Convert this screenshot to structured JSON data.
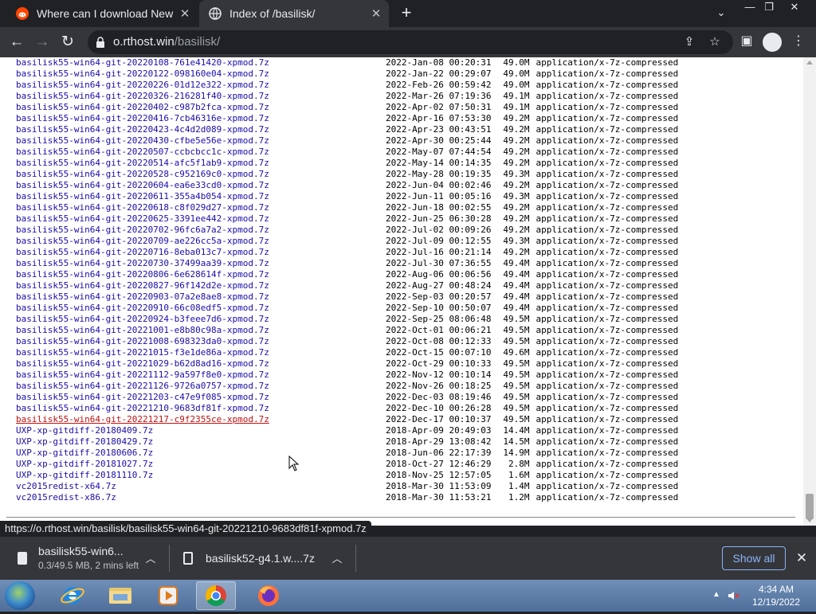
{
  "browser": {
    "tabs": [
      {
        "title": "Where can I download New M",
        "favicon": "reddit-icon",
        "active": false
      },
      {
        "title": "Index of /basilisk/",
        "favicon": "globe-icon",
        "active": true
      }
    ],
    "address": {
      "host": "o.rthost.win",
      "path": "/basilisk/"
    }
  },
  "listing": [
    {
      "name": "basilisk55-win64-git-20220108-761e41420-xpmod.7z",
      "date": "2022-Jan-08 00:20:31",
      "size": "49.0M",
      "type": "application/x-7z-compressed"
    },
    {
      "name": "basilisk55-win64-git-20220122-098160e04-xpmod.7z",
      "date": "2022-Jan-22 00:29:07",
      "size": "49.0M",
      "type": "application/x-7z-compressed"
    },
    {
      "name": "basilisk55-win64-git-20220226-01d12e322-xpmod.7z",
      "date": "2022-Feb-26 00:59:42",
      "size": "49.0M",
      "type": "application/x-7z-compressed"
    },
    {
      "name": "basilisk55-win64-git-20220326-216281f40-xpmod.7z",
      "date": "2022-Mar-26 07:19:36",
      "size": "49.1M",
      "type": "application/x-7z-compressed"
    },
    {
      "name": "basilisk55-win64-git-20220402-c987b2fca-xpmod.7z",
      "date": "2022-Apr-02 07:50:31",
      "size": "49.1M",
      "type": "application/x-7z-compressed"
    },
    {
      "name": "basilisk55-win64-git-20220416-7cb46316e-xpmod.7z",
      "date": "2022-Apr-16 07:53:30",
      "size": "49.2M",
      "type": "application/x-7z-compressed"
    },
    {
      "name": "basilisk55-win64-git-20220423-4c4d2d089-xpmod.7z",
      "date": "2022-Apr-23 00:43:51",
      "size": "49.2M",
      "type": "application/x-7z-compressed"
    },
    {
      "name": "basilisk55-win64-git-20220430-cfbe5e56e-xpmod.7z",
      "date": "2022-Apr-30 00:25:44",
      "size": "49.2M",
      "type": "application/x-7z-compressed"
    },
    {
      "name": "basilisk55-win64-git-20220507-ccbcbcc1c-xpmod.7z",
      "date": "2022-May-07 07:44:54",
      "size": "49.2M",
      "type": "application/x-7z-compressed"
    },
    {
      "name": "basilisk55-win64-git-20220514-afc5f1ab9-xpmod.7z",
      "date": "2022-May-14 00:14:35",
      "size": "49.2M",
      "type": "application/x-7z-compressed"
    },
    {
      "name": "basilisk55-win64-git-20220528-c952169c0-xpmod.7z",
      "date": "2022-May-28 00:19:35",
      "size": "49.3M",
      "type": "application/x-7z-compressed"
    },
    {
      "name": "basilisk55-win64-git-20220604-ea6e33cd0-xpmod.7z",
      "date": "2022-Jun-04 00:02:46",
      "size": "49.2M",
      "type": "application/x-7z-compressed"
    },
    {
      "name": "basilisk55-win64-git-20220611-355a4b054-xpmod.7z",
      "date": "2022-Jun-11 00:05:16",
      "size": "49.3M",
      "type": "application/x-7z-compressed"
    },
    {
      "name": "basilisk55-win64-git-20220618-c8f029d27-xpmod.7z",
      "date": "2022-Jun-18 00:02:55",
      "size": "49.2M",
      "type": "application/x-7z-compressed"
    },
    {
      "name": "basilisk55-win64-git-20220625-3391ee442-xpmod.7z",
      "date": "2022-Jun-25 06:30:28",
      "size": "49.2M",
      "type": "application/x-7z-compressed"
    },
    {
      "name": "basilisk55-win64-git-20220702-96fc6a7a2-xpmod.7z",
      "date": "2022-Jul-02 00:09:26",
      "size": "49.2M",
      "type": "application/x-7z-compressed"
    },
    {
      "name": "basilisk55-win64-git-20220709-ae226cc5a-xpmod.7z",
      "date": "2022-Jul-09 00:12:55",
      "size": "49.3M",
      "type": "application/x-7z-compressed"
    },
    {
      "name": "basilisk55-win64-git-20220716-8eba013c7-xpmod.7z",
      "date": "2022-Jul-16 00:21:14",
      "size": "49.2M",
      "type": "application/x-7z-compressed"
    },
    {
      "name": "basilisk55-win64-git-20220730-37499aa39-xpmod.7z",
      "date": "2022-Jul-30 07:36:55",
      "size": "49.4M",
      "type": "application/x-7z-compressed"
    },
    {
      "name": "basilisk55-win64-git-20220806-6e628614f-xpmod.7z",
      "date": "2022-Aug-06 00:06:56",
      "size": "49.4M",
      "type": "application/x-7z-compressed"
    },
    {
      "name": "basilisk55-win64-git-20220827-96f142d2e-xpmod.7z",
      "date": "2022-Aug-27 00:48:24",
      "size": "49.4M",
      "type": "application/x-7z-compressed"
    },
    {
      "name": "basilisk55-win64-git-20220903-07a2e8ae8-xpmod.7z",
      "date": "2022-Sep-03 00:20:57",
      "size": "49.4M",
      "type": "application/x-7z-compressed"
    },
    {
      "name": "basilisk55-win64-git-20220910-66c08edf5-xpmod.7z",
      "date": "2022-Sep-10 00:50:07",
      "size": "49.4M",
      "type": "application/x-7z-compressed"
    },
    {
      "name": "basilisk55-win64-git-20220924-b3feee7d6-xpmod.7z",
      "date": "2022-Sep-25 08:06:48",
      "size": "49.5M",
      "type": "application/x-7z-compressed"
    },
    {
      "name": "basilisk55-win64-git-20221001-e8b80c98a-xpmod.7z",
      "date": "2022-Oct-01 00:06:21",
      "size": "49.5M",
      "type": "application/x-7z-compressed"
    },
    {
      "name": "basilisk55-win64-git-20221008-698323da0-xpmod.7z",
      "date": "2022-Oct-08 00:12:33",
      "size": "49.5M",
      "type": "application/x-7z-compressed"
    },
    {
      "name": "basilisk55-win64-git-20221015-f3e1de86a-xpmod.7z",
      "date": "2022-Oct-15 00:07:10",
      "size": "49.6M",
      "type": "application/x-7z-compressed"
    },
    {
      "name": "basilisk55-win64-git-20221029-b62d8ad16-xpmod.7z",
      "date": "2022-Oct-29 00:10:33",
      "size": "49.5M",
      "type": "application/x-7z-compressed"
    },
    {
      "name": "basilisk55-win64-git-20221112-9a597f8e0-xpmod.7z",
      "date": "2022-Nov-12 00:10:14",
      "size": "49.5M",
      "type": "application/x-7z-compressed"
    },
    {
      "name": "basilisk55-win64-git-20221126-9726a0757-xpmod.7z",
      "date": "2022-Nov-26 00:18:25",
      "size": "49.5M",
      "type": "application/x-7z-compressed"
    },
    {
      "name": "basilisk55-win64-git-20221203-c47e9f085-xpmod.7z",
      "date": "2022-Dec-03 08:19:46",
      "size": "49.5M",
      "type": "application/x-7z-compressed"
    },
    {
      "name": "basilisk55-win64-git-20221210-9683df81f-xpmod.7z",
      "date": "2022-Dec-10 00:26:28",
      "size": "49.5M",
      "type": "application/x-7z-compressed"
    },
    {
      "name": "basilisk55-win64-git-20221217-c9f2355ce-xpmod.7z",
      "date": "2022-Dec-17 00:10:37",
      "size": "49.5M",
      "type": "application/x-7z-compressed",
      "visited": true
    },
    {
      "name": "UXP-xp-gitdiff-20180409.7z",
      "date": "2018-Apr-09 20:49:03",
      "size": "14.4M",
      "type": "application/x-7z-compressed"
    },
    {
      "name": "UXP-xp-gitdiff-20180429.7z",
      "date": "2018-Apr-29 13:08:42",
      "size": "14.5M",
      "type": "application/x-7z-compressed"
    },
    {
      "name": "UXP-xp-gitdiff-20180606.7z",
      "date": "2018-Jun-06 22:17:39",
      "size": "14.9M",
      "type": "application/x-7z-compressed"
    },
    {
      "name": "UXP-xp-gitdiff-20181027.7z",
      "date": "2018-Oct-27 12:46:29",
      "size": "2.8M",
      "type": "application/x-7z-compressed"
    },
    {
      "name": "UXP-xp-gitdiff-20181110.7z",
      "date": "2018-Nov-25 12:57:05",
      "size": "1.6M",
      "type": "application/x-7z-compressed"
    },
    {
      "name": "vc2015redist-x64.7z",
      "date": "2018-Mar-30 11:53:09",
      "size": "1.4M",
      "type": "application/x-7z-compressed"
    },
    {
      "name": "vc2015redist-x86.7z",
      "date": "2018-Mar-30 11:53:21",
      "size": "1.2M",
      "type": "application/x-7z-compressed"
    }
  ],
  "status_url": "https://o.rthost.win/basilisk/basilisk55-win64-git-20221210-9683df81f-xpmod.7z",
  "downloads": [
    {
      "name": "basilisk55-win6...",
      "status": "0.3/49.5 MB, 2 mins left"
    },
    {
      "name": "basilisk52-g4.1.w....7z",
      "status": ""
    }
  ],
  "downloads_show_all": "Show all",
  "clock": {
    "time": "4:34 AM",
    "date": "12/19/2022"
  },
  "colors": {
    "link": "#1a0dab",
    "visited_link": "#c01010",
    "chrome_dark": "#202124",
    "chrome_toolbar": "#35363a",
    "accent": "#8ab4f8"
  }
}
